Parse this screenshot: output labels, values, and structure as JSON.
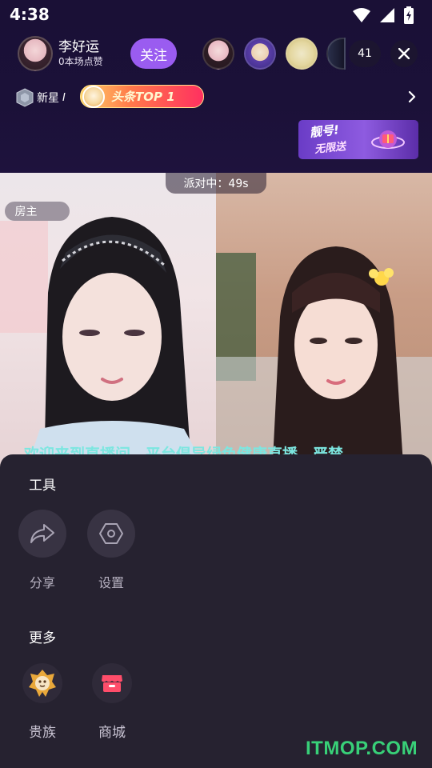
{
  "status_bar": {
    "time": "4:38"
  },
  "host": {
    "name": "李好运",
    "likes": "0本场点赞",
    "follow_label": "关注"
  },
  "viewers": {
    "count": "41"
  },
  "badges": {
    "level_label": "新星",
    "level_num": "I",
    "top_label": "头条TOP 1"
  },
  "promo": {
    "line1": "靓号!",
    "line2": "无限送"
  },
  "video": {
    "party_timer": "派对中：49s",
    "host_tag": "房主",
    "welcome_text": "欢迎来到直播间，平台倡导绿色健康直播，严禁"
  },
  "sheet": {
    "tools_title": "工具",
    "tools": [
      {
        "label": "分享"
      },
      {
        "label": "设置"
      }
    ],
    "more_title": "更多",
    "more": [
      {
        "label": "贵族"
      },
      {
        "label": "商城"
      }
    ]
  },
  "watermark": "ITMOP.COM",
  "colors": {
    "accent": "#9a5cf0",
    "sheet_bg": "#262230",
    "welcome": "#7ce6e0",
    "watermark": "#38d078"
  },
  "icons": [
    "wifi-icon",
    "signal-icon",
    "battery-icon",
    "close-icon",
    "chevron-right-icon",
    "level-shield-icon",
    "share-icon",
    "settings-icon",
    "noble-icon",
    "shop-icon"
  ]
}
